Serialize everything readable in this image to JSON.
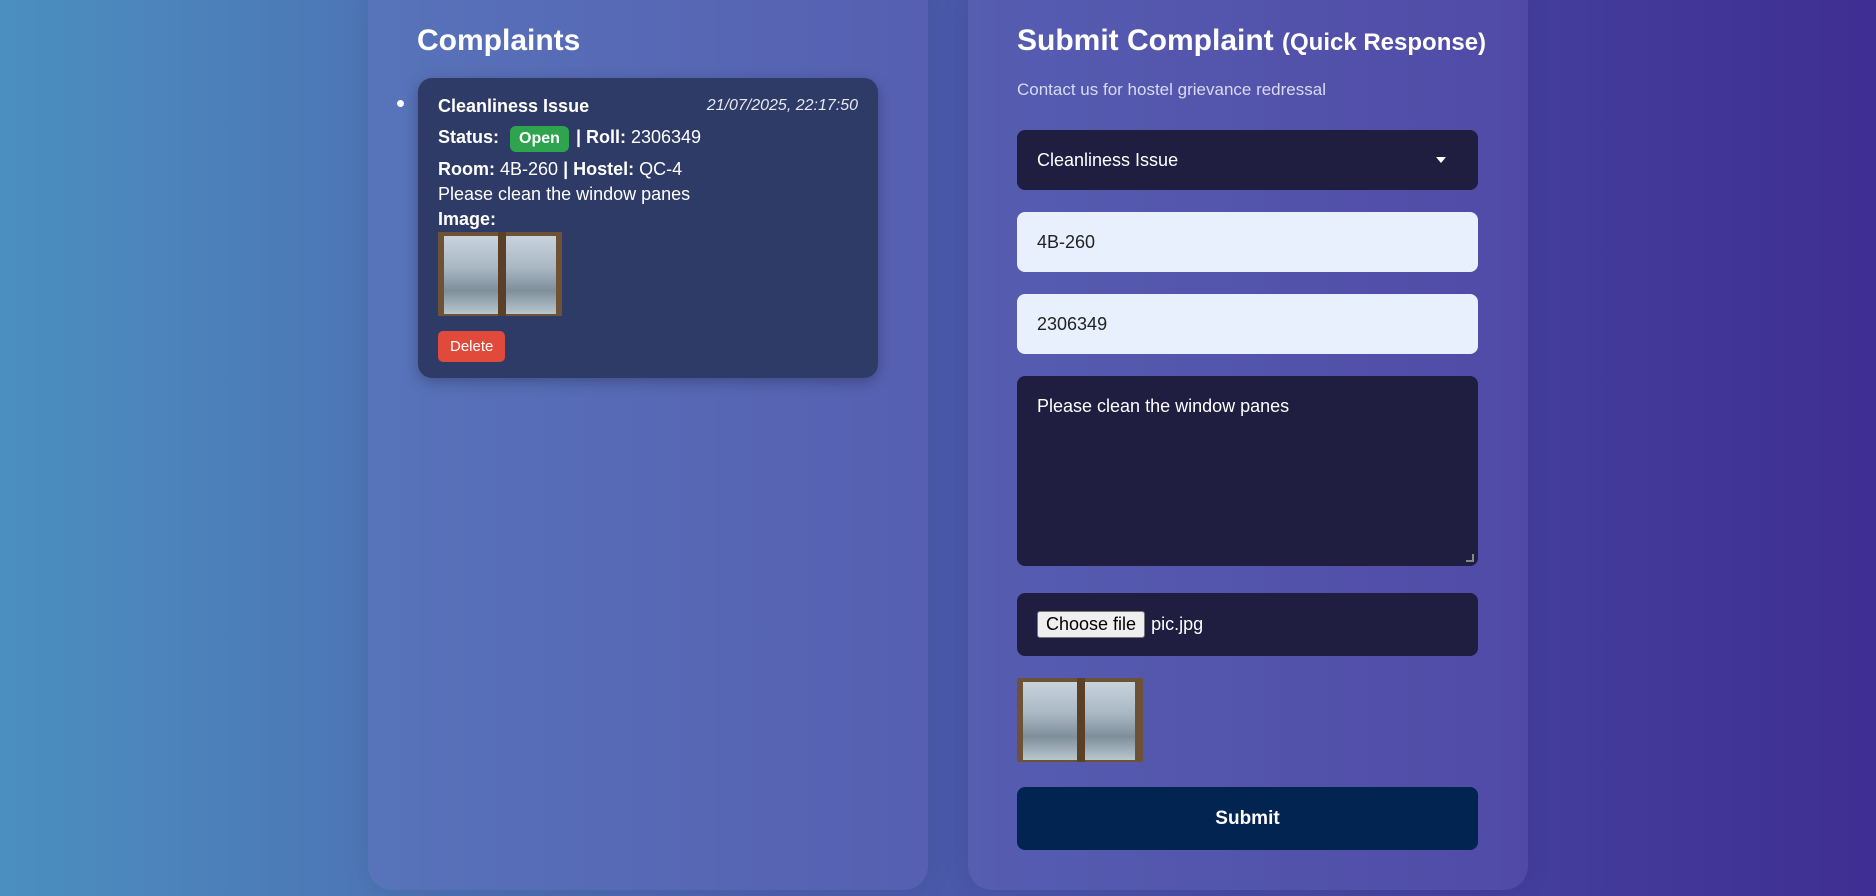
{
  "complaints": {
    "heading": "Complaints",
    "items": [
      {
        "title": "Cleanliness Issue",
        "timestamp": "21/07/2025, 22:17:50",
        "status_label": "Status:",
        "status": "Open",
        "roll_label": "| Roll:",
        "roll": "2306349",
        "room_label": "Room:",
        "room": "4B-260",
        "hostel_label": "| Hostel:",
        "hostel": "QC-4",
        "description": "Please clean the window panes",
        "image_label": "Image:",
        "delete_label": "Delete"
      }
    ]
  },
  "form": {
    "heading": "Submit Complaint",
    "heading_suffix": "(Quick Response)",
    "subtitle": "Contact us for hostel grievance redressal",
    "category_value": "Cleanliness Issue",
    "room_value": "4B-260",
    "roll_value": "2306349",
    "description_value": "Please clean the window panes",
    "file_button_label": "Choose file",
    "file_name": "pic.jpg",
    "submit_label": "Submit"
  },
  "colors": {
    "status_open": "#2ea44f",
    "delete": "#e04a3b",
    "submit": "#012451"
  }
}
